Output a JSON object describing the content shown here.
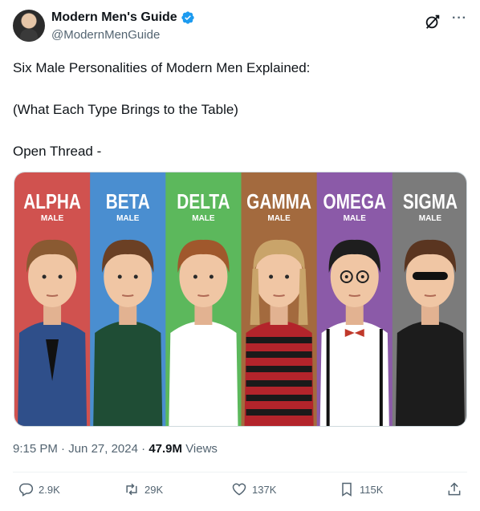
{
  "author": {
    "display_name": "Modern Men's Guide",
    "handle": "@ModernMenGuide",
    "verified": true
  },
  "icons": {
    "verified": "verified-badge-icon",
    "grok": "grok-icon",
    "more": "more-icon",
    "reply": "reply-icon",
    "retweet": "retweet-icon",
    "like": "like-icon",
    "bookmark": "bookmark-icon",
    "share": "share-icon"
  },
  "more_glyph": "···",
  "text_lines": [
    "Six Male Personalities of Modern Men Explained:",
    "",
    "(What Each Type Brings to the Table)",
    "",
    "Open Thread -"
  ],
  "media": {
    "panels": [
      {
        "title": "ALPHA",
        "subtitle": "MALE",
        "color": "#d0524f"
      },
      {
        "title": "BETA",
        "subtitle": "MALE",
        "color": "#4a8ed0"
      },
      {
        "title": "DELTA",
        "subtitle": "MALE",
        "color": "#5cb85c"
      },
      {
        "title": "GAMMA",
        "subtitle": "MALE",
        "color": "#a36a3e"
      },
      {
        "title": "OMEGA",
        "subtitle": "MALE",
        "color": "#8b5aa8"
      },
      {
        "title": "SIGMA",
        "subtitle": "MALE",
        "color": "#7b7b7b"
      }
    ]
  },
  "meta": {
    "time": "9:15 PM",
    "sep": " · ",
    "date": "Jun 27, 2024",
    "views_count": "47.9M",
    "views_label": "Views"
  },
  "actions": {
    "replies": "2.9K",
    "retweets": "29K",
    "likes": "137K",
    "bookmarks": "115K"
  },
  "colors": {
    "verified": "#1d9bf0",
    "text": "#0f1419",
    "muted": "#536471"
  }
}
